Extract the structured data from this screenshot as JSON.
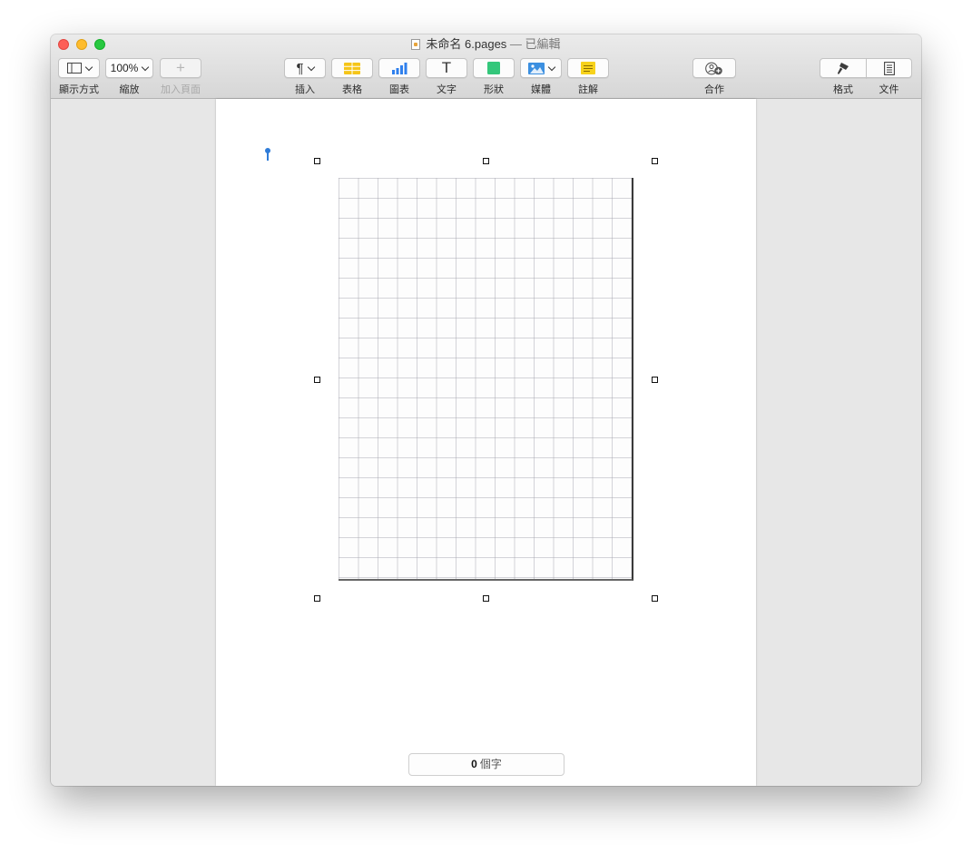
{
  "window": {
    "title": "未命名 6.pages",
    "separator": "—",
    "status": "已編輯"
  },
  "toolbar": {
    "view_label": "顯示方式",
    "zoom_value": "100%",
    "zoom_label": "縮放",
    "add_page_label": "加入頁面",
    "add_page_symbol": "+",
    "insert_symbol": "¶",
    "insert_label": "插入",
    "table_label": "表格",
    "chart_label": "圖表",
    "text_symbol": "T",
    "text_label": "文字",
    "shape_label": "形狀",
    "media_label": "媒體",
    "comment_label": "註解",
    "collaborate_label": "合作",
    "format_label": "格式",
    "document_label": "文件"
  },
  "colors": {
    "table_icon": "#f5c518",
    "chart_icon": "#2f80ed",
    "shape_icon": "#34c77b",
    "media_icon": "#3b8fe0",
    "comment_icon": "#f7d21b"
  },
  "status_bar": {
    "word_count": "0",
    "word_unit": "個字"
  }
}
